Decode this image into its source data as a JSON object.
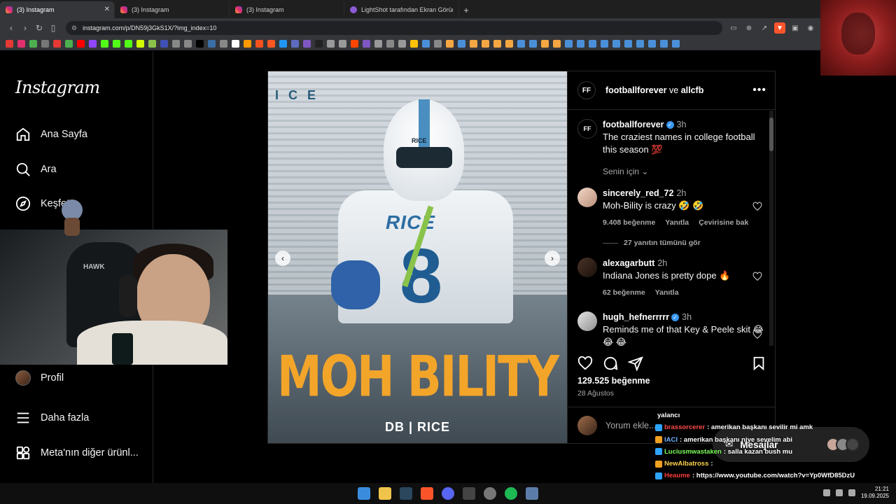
{
  "browser": {
    "tabs": [
      {
        "title": "(3) Instagram",
        "active": true
      },
      {
        "title": "(3) Instagram",
        "active": false
      },
      {
        "title": "(3) Instagram",
        "active": false
      },
      {
        "title": "LightShot tarafından Ekran Görüntüs",
        "active": false
      }
    ],
    "url": "instagram.com/p/DN59j3GkS1X/?img_index=10"
  },
  "sidebar": {
    "logo": "Instagram",
    "items": [
      {
        "label": "Ana Sayfa",
        "icon": "home-icon"
      },
      {
        "label": "Ara",
        "icon": "search-icon"
      },
      {
        "label": "Keşfet",
        "icon": "compass-icon"
      },
      {
        "label": "Profil",
        "icon": "avatar"
      },
      {
        "label": "Daha fazla",
        "icon": "menu-icon"
      },
      {
        "label": "Meta'nın diğer ürünl...",
        "icon": "apps-icon"
      }
    ]
  },
  "webcam": {
    "chair_brand": "HAWK"
  },
  "post": {
    "image": {
      "stadium_text": "ICE",
      "helmet_text": "RICE",
      "jersey_text": "RICE",
      "jersey_number": "8",
      "headline": "MOH BILITY",
      "subline": "DB | RICE"
    },
    "header": {
      "author": "footballforever",
      "connector": "ve",
      "coauthor": "allcfb",
      "logo_text": "FF"
    },
    "caption": {
      "user": "footballforever",
      "time": "3h",
      "text": "The craziest names in college football this season 💯"
    },
    "senin_icin": "Senin için",
    "comments": [
      {
        "user": "sincerely_red_72",
        "time": "2h",
        "text": "Moh-Bility is crazy 🤣 🤣",
        "likes": "9.408 beğenme",
        "reply": "Yanıtla",
        "translate": "Çevirisine bak"
      },
      {
        "user": "alexagarbutt",
        "time": "2h",
        "text": "Indiana Jones is pretty dope 🔥",
        "likes": "62 beğenme",
        "reply": "Yanıtla"
      },
      {
        "user": "hugh_hefnerrrrr",
        "time": "3h",
        "text": "Reminds me of that Key & Peele skit 😂 😂 😂"
      }
    ],
    "view_replies": "27 yanıtın tümünü gör",
    "like_count": "129.525 beğenme",
    "date": "28 Ağustos",
    "add_comment_placeholder": "Yorum ekle..."
  },
  "chat": {
    "messages": [
      {
        "user": "",
        "color": "#ffffff",
        "text": "yalancı"
      },
      {
        "user": "brassorcerer",
        "color": "#ff4b4b",
        "text": ": amerikan başkanı sevilir mi amk"
      },
      {
        "user": "IACI",
        "color": "#6fb3ff",
        "text": ": amerikan başkanı niye sevelim abi"
      },
      {
        "user": "Luciusmwastaken",
        "color": "#7cff5b",
        "text": ": salla kazan bush mu"
      },
      {
        "user": "NewAlbatross",
        "color": "#ffd34a",
        "text": ":"
      },
      {
        "user": "Heaume",
        "color": "#ff3c3c",
        "text": ": https://www.youtube.com/watch?v=Yp0WfD85DzU"
      },
      {
        "user": "NewAlbatross",
        "color": "#ffd34a",
        "text": ":"
      }
    ],
    "messages_label": "Mesajlar"
  },
  "taskbar": {
    "time": "21:21",
    "date": "19.09.2025"
  }
}
